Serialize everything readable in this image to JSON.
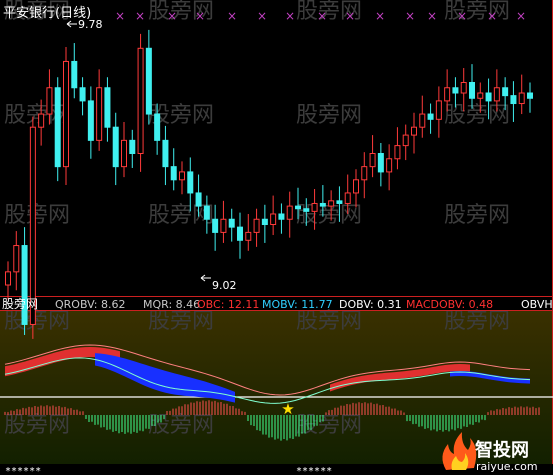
{
  "top_panel": {
    "title": "平安银行(日线)",
    "high_marker": "9.78",
    "low_marker": "9.02",
    "watermark": "股旁网",
    "marker_glyph": "×"
  },
  "indicator_panel": {
    "source_label": "股旁网",
    "readouts": [
      {
        "label": "QROBV: 8.62",
        "color": "#c8c8c8"
      },
      {
        "label": "MQR: 8.46",
        "color": "#c8c8c8"
      },
      {
        "label": "OBC: 12.11",
        "color": "#ff3030"
      },
      {
        "label": "MOBV: 11.77",
        "color": "#30d0ff"
      },
      {
        "label": "DOBV: 0.31",
        "color": "#ffffff"
      },
      {
        "label": "MACDOBV: 0.48",
        "color": "#ff3030"
      },
      {
        "label": "OBVH",
        "color": "#ffffff"
      }
    ],
    "signal_glyph": "★",
    "bottom_marks": "******"
  },
  "brand": {
    "name": "智投网",
    "url": "raiyue.com"
  },
  "chart_data": [
    {
      "type": "candlestick",
      "title": "平安银行(日线)",
      "annotations": [
        "9.78",
        "9.02"
      ],
      "close": [
        8.9,
        9.0,
        8.7,
        9.45,
        9.5,
        9.6,
        9.3,
        9.7,
        9.6,
        9.55,
        9.4,
        9.6,
        9.45,
        9.3,
        9.4,
        9.35,
        9.75,
        9.5,
        9.4,
        9.3,
        9.25,
        9.28,
        9.2,
        9.15,
        9.1,
        9.05,
        9.1,
        9.07,
        9.02,
        9.05,
        9.1,
        9.08,
        9.12,
        9.1,
        9.15,
        9.14,
        9.13,
        9.16,
        9.15,
        9.17,
        9.16,
        9.2,
        9.25,
        9.3,
        9.35,
        9.28,
        9.33,
        9.38,
        9.42,
        9.45,
        9.5,
        9.48,
        9.55,
        9.6,
        9.58,
        9.62,
        9.56,
        9.58,
        9.55,
        9.6,
        9.57,
        9.54,
        9.58,
        9.56
      ],
      "highs": [
        9.78
      ],
      "lows": [
        9.02
      ]
    },
    {
      "type": "line",
      "series": [
        {
          "name": "QROBV",
          "last": 8.62
        },
        {
          "name": "MQR",
          "last": 8.46
        },
        {
          "name": "OBC",
          "last": 12.11
        },
        {
          "name": "MOBV",
          "last": 11.77
        },
        {
          "name": "DOBV",
          "last": 0.31
        },
        {
          "name": "MACDOBV",
          "last": 0.48
        }
      ]
    }
  ],
  "colors": {
    "up": "#ff3a3a",
    "down": "#40f0f0",
    "indicator_bg_top": "#3a3000",
    "indicator_bg_bottom": "#1a2a00",
    "band_red": "#e03030",
    "band_blue": "#1830ff",
    "signal": "#ffe000",
    "marker": "#c040c0",
    "watermark": "#3c3c3c"
  }
}
